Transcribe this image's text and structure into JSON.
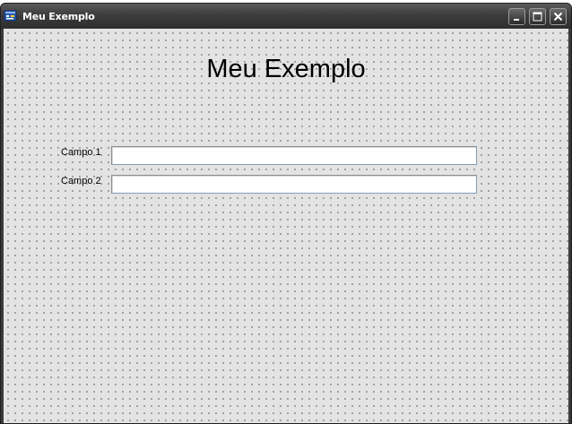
{
  "window": {
    "title": "Meu Exemplo",
    "icon": "application-icon",
    "controls": {
      "minimize": "minimize-icon",
      "maximize": "maximize-icon",
      "close": "close-icon"
    }
  },
  "form": {
    "heading": "Meu Exemplo",
    "fields": [
      {
        "label": "Campo 1",
        "value": "",
        "placeholder": ""
      },
      {
        "label": "Campo 2",
        "value": "",
        "placeholder": ""
      }
    ]
  },
  "colors": {
    "titlebar": "#3d3d3d",
    "client_background": "#e3e3e3",
    "grid_dots": "#4a4a4a"
  }
}
